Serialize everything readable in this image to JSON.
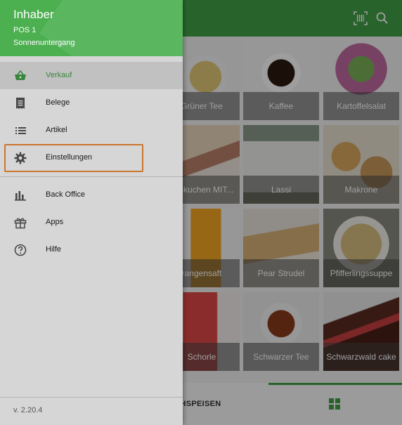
{
  "drawer": {
    "user_name": "Inhaber",
    "pos_name": "POS 1",
    "store_name": "Sonnenuntergang",
    "items": [
      {
        "label": "Verkauf",
        "icon": "basket-icon",
        "selected": true
      },
      {
        "label": "Belege",
        "icon": "receipt-icon"
      },
      {
        "label": "Artikel",
        "icon": "list-icon"
      },
      {
        "label": "Einstellungen",
        "icon": "gear-icon",
        "highlighted": true
      },
      {
        "label": "Back Office",
        "icon": "bar-chart-icon"
      },
      {
        "label": "Apps",
        "icon": "gift-icon"
      },
      {
        "label": "Hilfe",
        "icon": "help-icon"
      }
    ],
    "version": "v. 2.20.4"
  },
  "products": [
    {
      "name": "Grüner Tee",
      "color": "#c9b37a"
    },
    {
      "name": "Kaffee",
      "color": "#3a2a20"
    },
    {
      "name": "Kartoffelsalat",
      "color": "#b06a9a"
    },
    {
      "name": "äsekuchen MIT...",
      "color": "#c7a68a"
    },
    {
      "name": "Lassi",
      "color": "#d8d6d0"
    },
    {
      "name": "Makrone",
      "color": "#c99a5c"
    },
    {
      "name": "rangensaft",
      "color": "#f0a830"
    },
    {
      "name": "Pear Strudel",
      "color": "#d0b48a"
    },
    {
      "name": "Pfifferlingssuppe",
      "color": "#c8b27a"
    },
    {
      "name": "Schorle",
      "color": "#d84a4a"
    },
    {
      "name": "Schwarzer Tee",
      "color": "#8a3a1a"
    },
    {
      "name": "Schwarzwald cake",
      "color": "#5a2a20"
    }
  ],
  "bottom": {
    "tab_label": "ACHSPEISEN"
  },
  "colors": {
    "primary": "#43a047",
    "highlight_border": "#f28c38"
  }
}
